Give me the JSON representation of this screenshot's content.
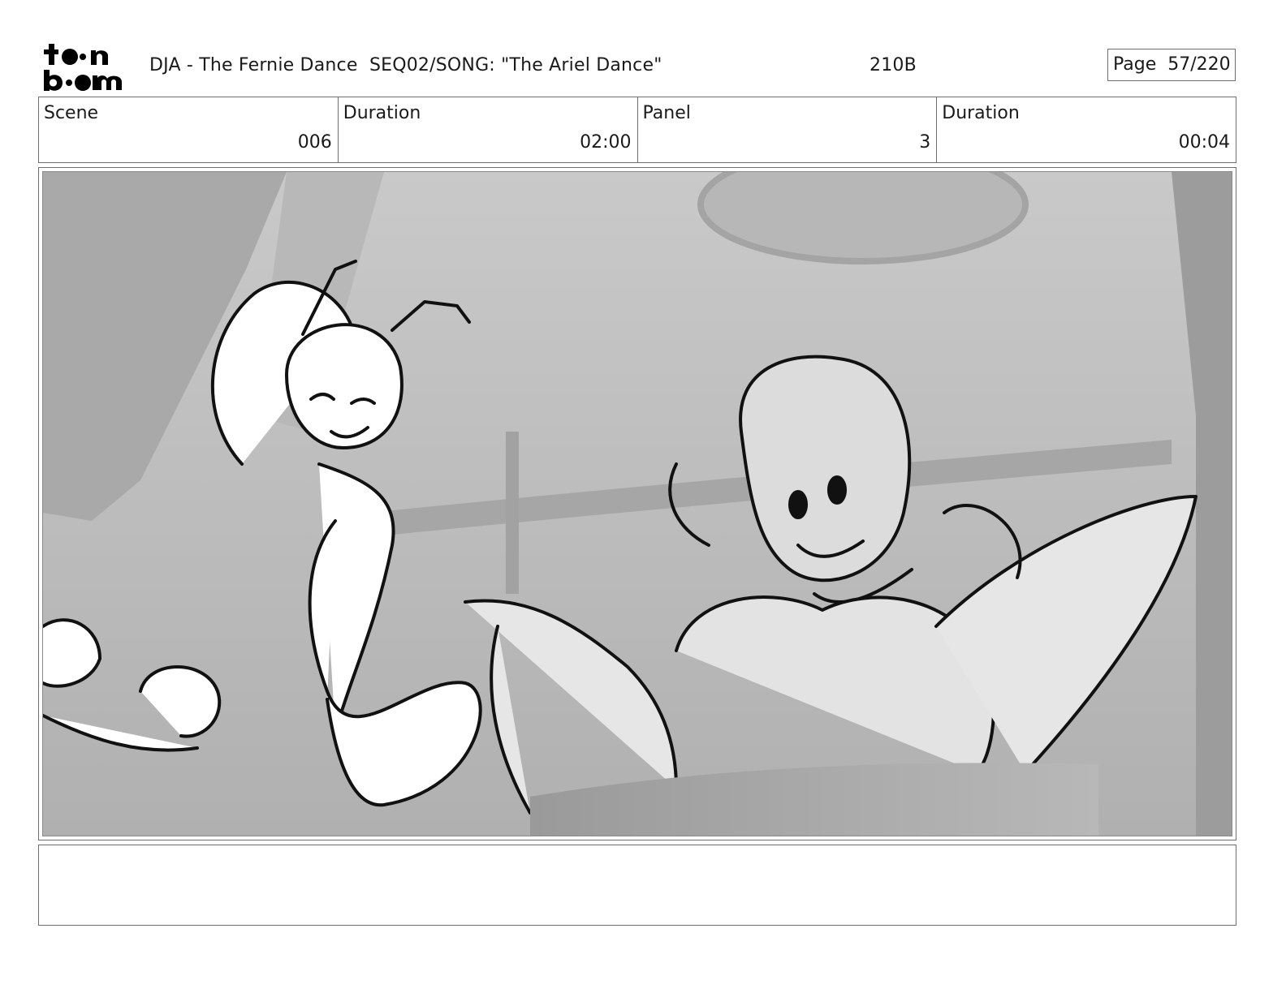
{
  "logo": {
    "line1": "to n",
    "line2": "b m",
    "icon": "toonboom-logo"
  },
  "header": {
    "title": "DJA - The Fernie Dance  SEQ02/SONG: \"The Ariel Dance\"",
    "code": "210B",
    "page_label": "Page  57/220"
  },
  "info": {
    "scene_label": "Scene",
    "scene_value": "006",
    "duration_label": "Duration",
    "duration_value": "02:00",
    "panel_label": "Panel",
    "panel_value": "3",
    "panel_duration_label": "Duration",
    "panel_duration_value": "00:04"
  },
  "panel_image": {
    "icon": "storyboard-sketch-mermaid-and-octopus"
  },
  "notes": {
    "text": ""
  },
  "colors": {
    "border": "#6e6e6e",
    "background_3d": "#b4b4b4",
    "sketch_line": "#111111"
  }
}
